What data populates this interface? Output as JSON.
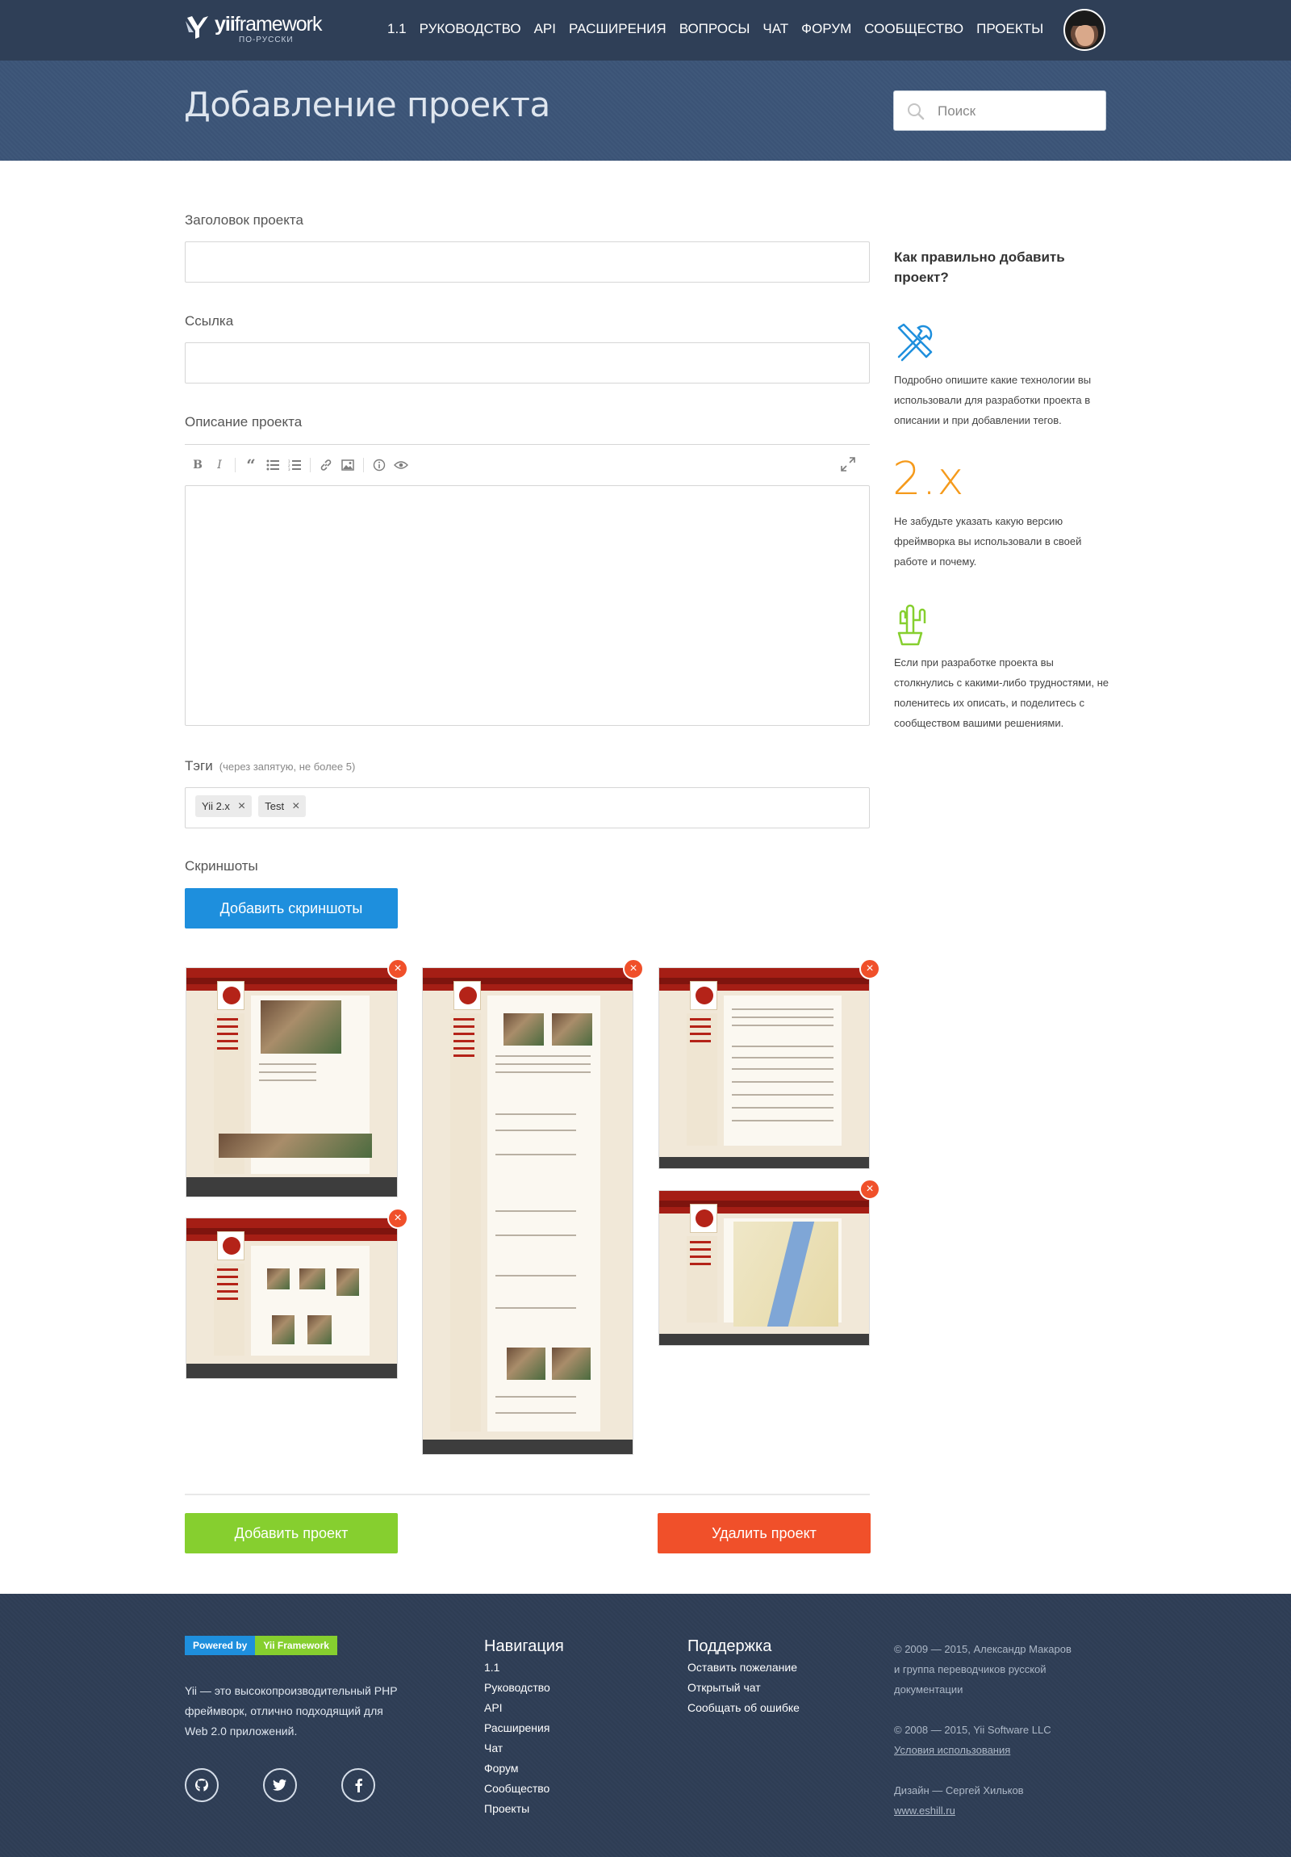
{
  "header": {
    "logo_text_bold": "yii",
    "logo_text": "framework",
    "logo_sub": "ПО-РУССКИ",
    "nav": [
      "1.1",
      "РУКОВОДСТВО",
      "API",
      "РАСШИРЕНИЯ",
      "ВОПРОСЫ",
      "ЧАТ",
      "ФОРУМ",
      "СООБЩЕСТВО",
      "ПРОЕКТЫ"
    ]
  },
  "hero": {
    "title": "Добавление проекта",
    "search_placeholder": "Поиск"
  },
  "form": {
    "title_label": "Заголовок проекта",
    "link_label": "Ссылка",
    "description_label": "Описание проекта",
    "tags_label": "Тэги",
    "tags_hint": "(через запятую, не более 5)",
    "tags": [
      {
        "label": "Yii 2.x",
        "remove": "×"
      },
      {
        "label": "Test",
        "remove": "×"
      }
    ],
    "screenshots_label": "Скриншоты",
    "add_screenshots_button": "Добавить скриншоты",
    "remove_screenshot": "×",
    "add_project_button": "Добавить проект",
    "delete_project_button": "Удалить проект"
  },
  "editor_toolbar": [
    "bold-icon",
    "italic-icon",
    "quote-icon",
    "unordered-list-icon",
    "ordered-list-icon",
    "link-icon",
    "image-icon",
    "info-icon",
    "preview-eye-icon",
    "fullscreen-icon"
  ],
  "help": {
    "title": "Как правильно добавить проект?",
    "items": [
      {
        "icon": "tools-icon",
        "text": "Подробно опишите какие технологии вы использовали для разработки проекта в описании и при добавлении тегов."
      },
      {
        "icon": "version-2x",
        "big": "2.x",
        "text": "Не забудьте указать какую версию фреймворка вы использовали в своей работе и почему."
      },
      {
        "icon": "cactus-icon",
        "text": "Если при разработке проекта вы столкнулись с какими-либо трудностями, не поленитесь их описать, и поделитесь с сообществом вашими решениями."
      }
    ]
  },
  "footer": {
    "powered_a": "Powered by",
    "powered_b": "Yii Framework",
    "about": "Yii — это высокопроизводительный PHP фреймворк, отлично подходящий для Web 2.0 приложений.",
    "social": [
      "github-icon",
      "twitter-icon",
      "facebook-icon"
    ],
    "nav_title": "Навигация",
    "nav_links": [
      "1.1",
      "Руководство",
      "API",
      "Расширения",
      "Чат",
      "Форум",
      "Сообщество",
      "Проекты"
    ],
    "support_title": "Поддержка",
    "support_links": [
      "Оставить пожелание",
      "Открытый чат",
      "Сообщать об ошибке"
    ],
    "copy1": "© 2009 — 2015, Александр Макаров и группа переводчиков русской документации",
    "copy2": "© 2008 — 2015, Yii Software LLC",
    "terms": "Условия использования",
    "design": "Дизайн — Сергей Хильков",
    "design_link": "www.eshill.ru"
  },
  "colors": {
    "header_bg": "#2f3f57",
    "hero_bg": "#3c5578",
    "blue": "#1e8fdd",
    "green": "#86cf2f",
    "red": "#f0502a",
    "orange": "#f59a1b"
  }
}
